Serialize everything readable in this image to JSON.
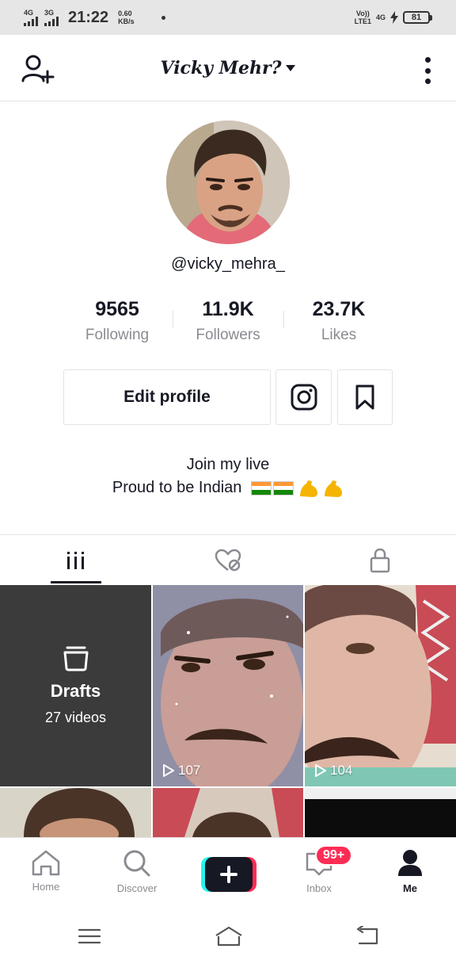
{
  "status_bar": {
    "network1": "4G",
    "network2": "3G",
    "time": "21:22",
    "speed_value": "0.60",
    "speed_unit": "KB/s",
    "volte_top": "Vo))",
    "volte_bottom": "LTE1",
    "network3": "4G",
    "battery": "81"
  },
  "header": {
    "username": "Vicky Mehr?"
  },
  "profile": {
    "handle": "@vicky_mehra_",
    "stats": [
      {
        "value": "9565",
        "label": "Following"
      },
      {
        "value": "11.9K",
        "label": "Followers"
      },
      {
        "value": "23.7K",
        "label": "Likes"
      }
    ],
    "edit_button": "Edit profile",
    "bio_line1": "Join my live",
    "bio_line2": "Proud to be Indian"
  },
  "grid": {
    "drafts_title": "Drafts",
    "drafts_count": "27 videos",
    "videos": [
      {
        "views": "107"
      },
      {
        "views": "104"
      }
    ]
  },
  "bottom_nav": {
    "home": "Home",
    "discover": "Discover",
    "inbox": "Inbox",
    "inbox_badge": "99+",
    "me": "Me"
  },
  "colors": {
    "accent_red": "#fe2c55",
    "accent_cyan": "#25f4ee",
    "text_primary": "#161823",
    "text_secondary": "#8a8b91"
  }
}
